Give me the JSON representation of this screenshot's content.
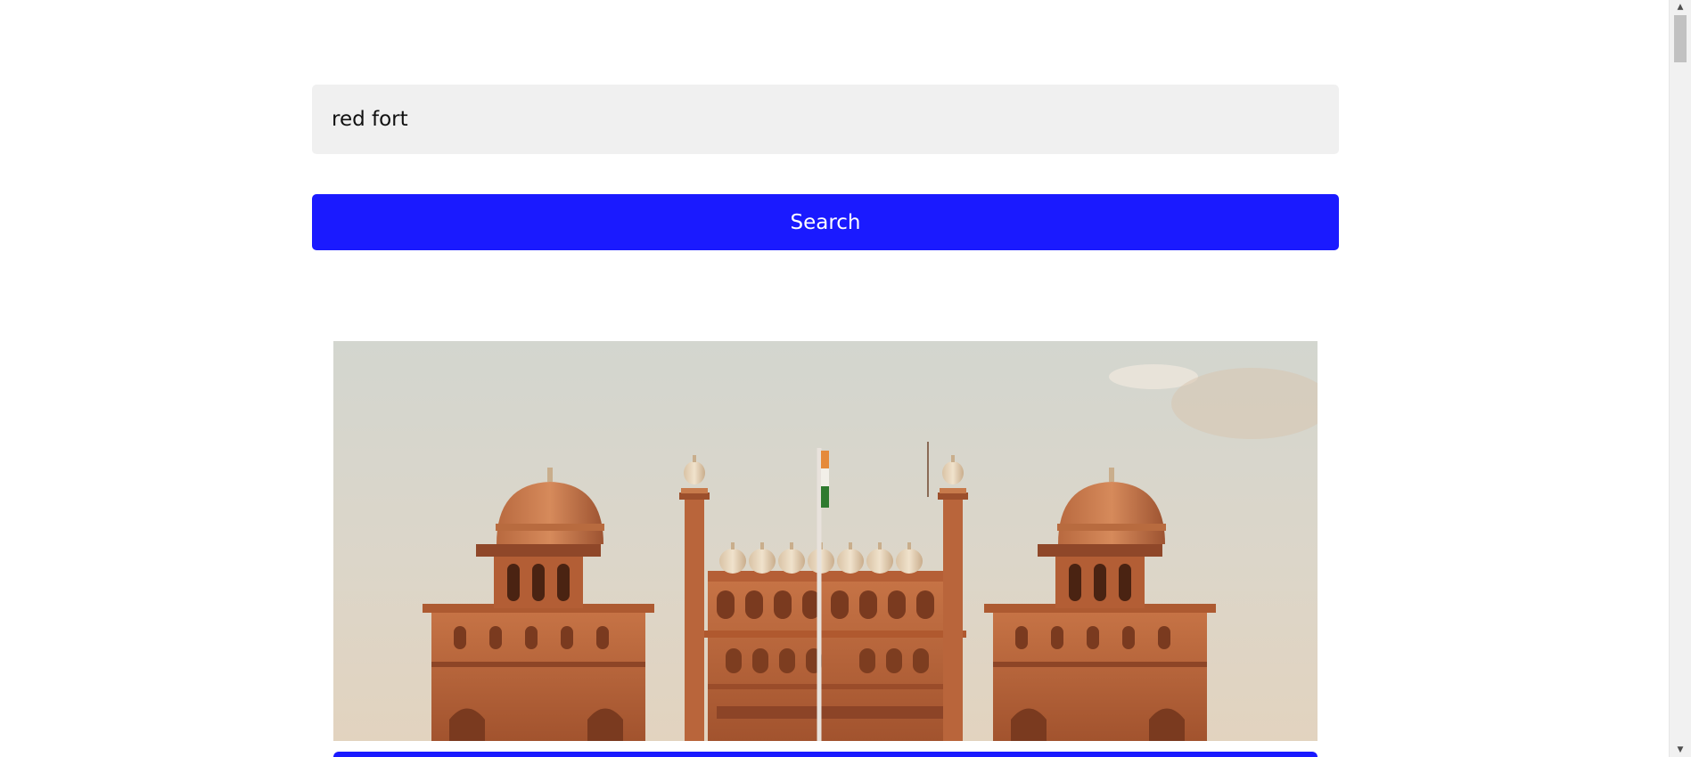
{
  "search": {
    "value": "red fort",
    "button_label": "Search",
    "button_color": "#1a1aff"
  },
  "result": {
    "image_subject": "red-fort-lahori-gate-photo",
    "button_color": "#1a1aff"
  },
  "scrollbar": {
    "up_icon": "▲",
    "down_icon": "▼"
  }
}
